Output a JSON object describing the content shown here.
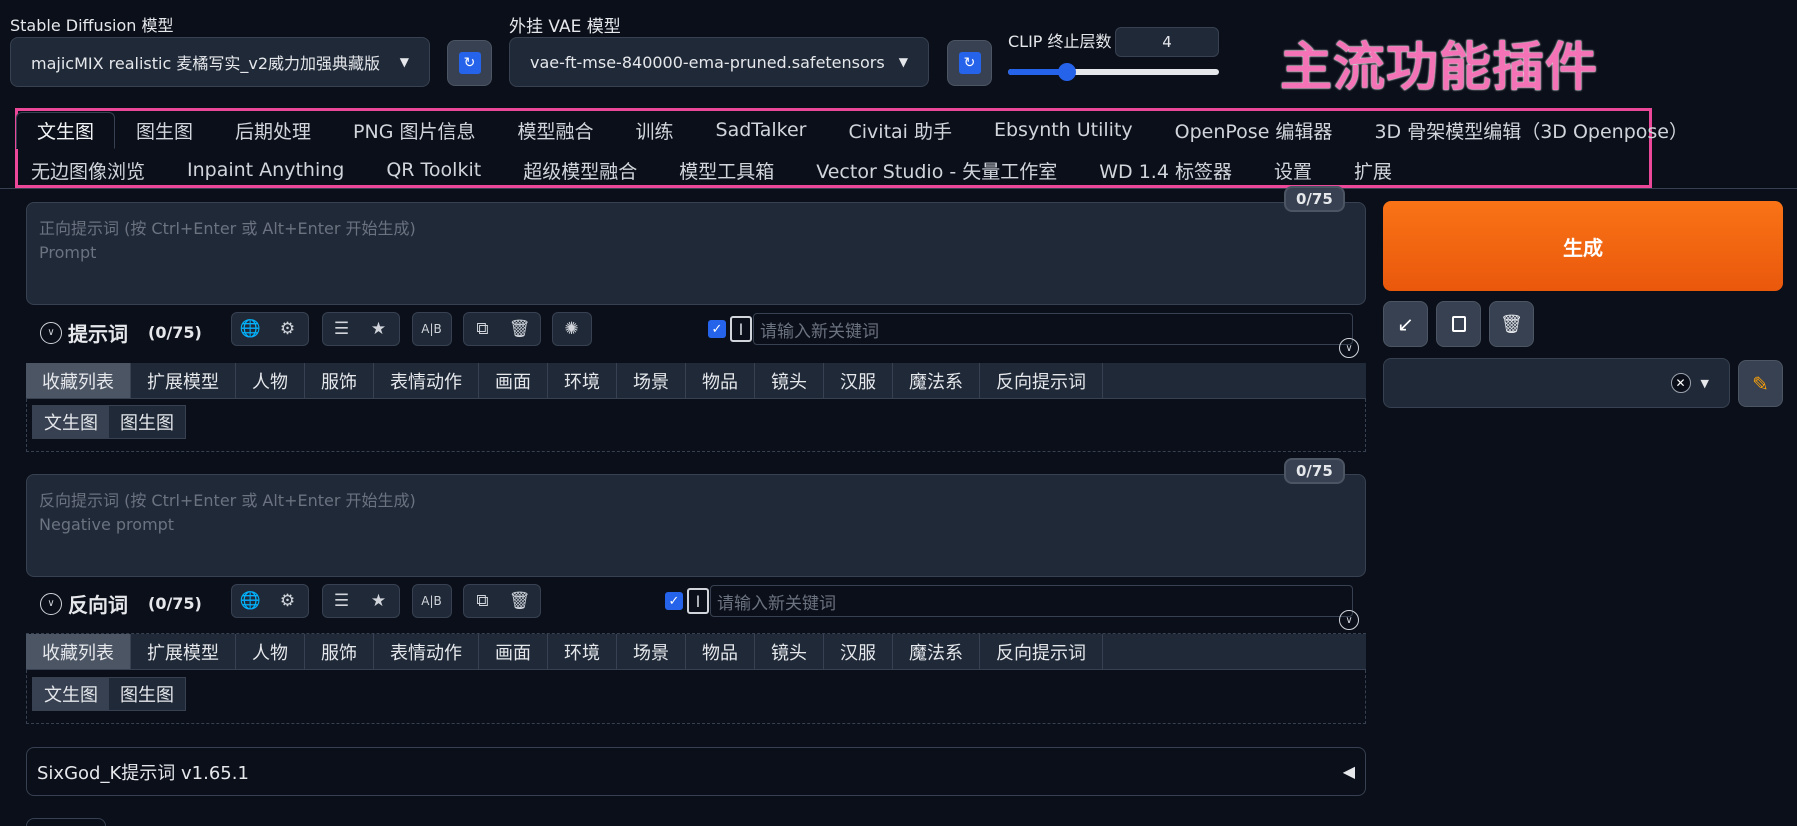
{
  "top": {
    "sd_model_label": "Stable Diffusion 模型",
    "sd_model_value": "majicMIX realistic 麦橘写实_v2威力加强典藏版",
    "vae_label": "外挂 VAE 模型",
    "vae_value": "vae-ft-mse-840000-ema-pruned.safetensors",
    "clip_label": "CLIP 终止层数",
    "clip_value": "4",
    "clip_slider_fraction": 0.28,
    "annotation": "主流功能插件",
    "refresh_icon": "refresh-icon"
  },
  "tabs_row1": [
    "文生图",
    "图生图",
    "后期处理",
    "PNG 图片信息",
    "模型融合",
    "训练",
    "SadTalker",
    "Civitai 助手",
    "Ebsynth Utility",
    "OpenPose 编辑器",
    "3D 骨架模型编辑（3D Openpose）"
  ],
  "tabs_row2": [
    "无边图像浏览",
    "Inpaint Anything",
    "QR Toolkit",
    "超级模型融合",
    "模型工具箱",
    "Vector Studio - 矢量工作室",
    "WD 1.4 标签器",
    "设置",
    "扩展"
  ],
  "prompt": {
    "placeholder_line1": "正向提示词 (按 Ctrl+Enter 或 Alt+Enter 开始生成)",
    "placeholder_line2": "Prompt",
    "counter": "0/75",
    "section_title": "提示词",
    "section_count": "(0/75)",
    "keyword_placeholder": "请输入新关键词"
  },
  "negative": {
    "placeholder_line1": "反向提示词 (按 Ctrl+Enter 或 Alt+Enter 开始生成)",
    "placeholder_line2": "Negative prompt",
    "counter": "0/75",
    "section_title": "反向词",
    "section_count": "(0/75)",
    "keyword_placeholder": "请输入新关键词"
  },
  "categories": [
    "收藏列表",
    "扩展模型",
    "人物",
    "服饰",
    "表情动作",
    "画面",
    "环境",
    "场景",
    "物品",
    "镜头",
    "汉服",
    "魔法系",
    "反向提示词"
  ],
  "subtabs": [
    "文生图",
    "图生图"
  ],
  "right": {
    "generate_label": "生成",
    "accent": "#f97316"
  },
  "footer": {
    "extension_title": "SixGod_K提示词 v1.65.1"
  },
  "colors": {
    "background": "#0b0f19",
    "panel": "#1f2937",
    "highlight_box": "#ec4899",
    "annotation_text": "#f472b6",
    "checkbox": "#2563eb"
  }
}
